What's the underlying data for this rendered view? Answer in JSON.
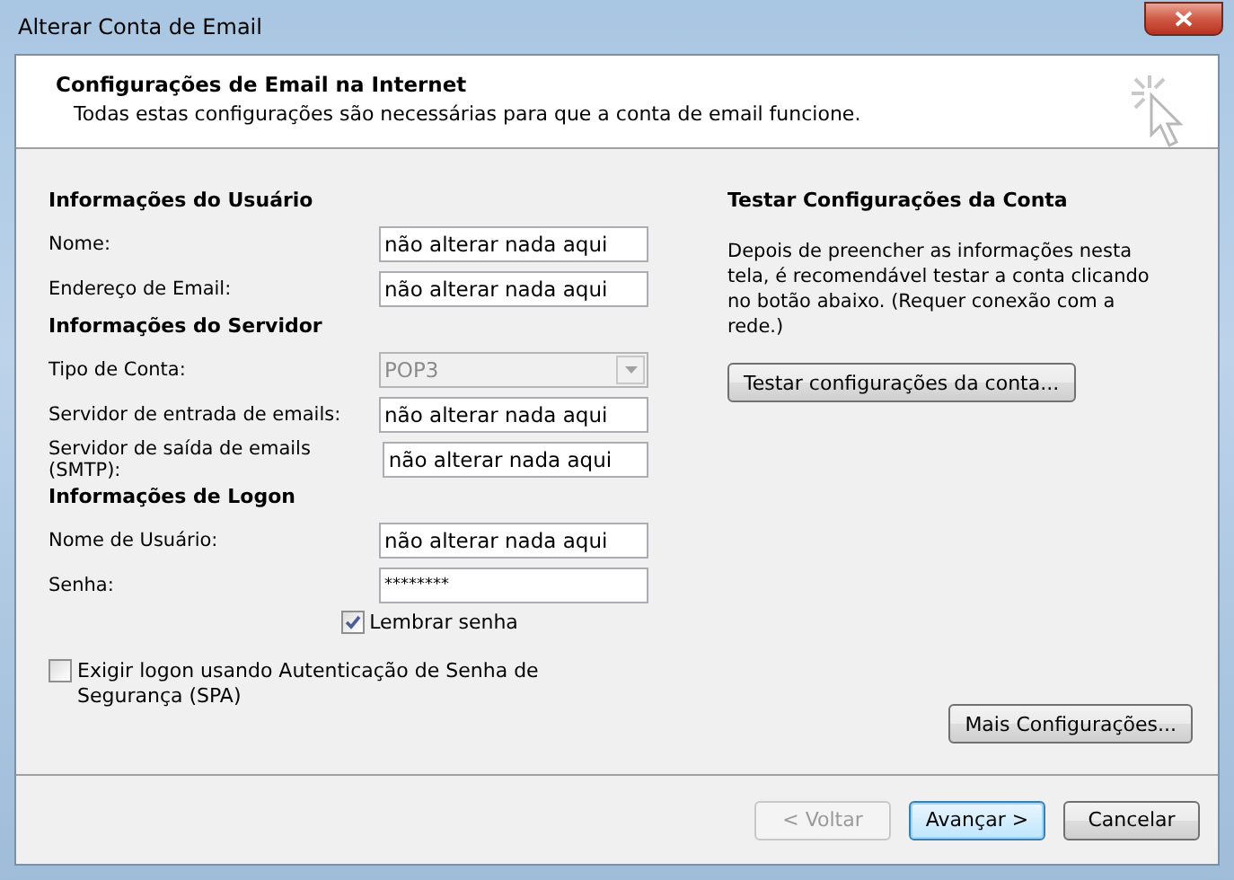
{
  "window": {
    "title": "Alterar Conta de Email"
  },
  "header": {
    "title": "Configurações de Email na Internet",
    "subtitle": "Todas estas configurações são necessárias para que a conta de email funcione."
  },
  "sections": [
    {
      "heading": "Informações do Usuário",
      "fields": [
        {
          "kind": "text",
          "label": "Nome:",
          "value": "não alterar nada aqui"
        },
        {
          "kind": "text",
          "label": "Endereço de Email:",
          "value": "não alterar nada aqui"
        }
      ]
    },
    {
      "heading": "Informações do Servidor",
      "fields": [
        {
          "kind": "select",
          "label": "Tipo de Conta:",
          "value": "POP3",
          "disabled": true
        },
        {
          "kind": "text",
          "label": "Servidor de entrada de emails:",
          "value": "não alterar nada aqui"
        },
        {
          "kind": "text",
          "label": "Servidor de saída de emails (SMTP):",
          "value": "não alterar nada aqui"
        }
      ]
    },
    {
      "heading": "Informações de Logon",
      "fields": [
        {
          "kind": "text",
          "label": "Nome de Usuário:",
          "value": "não alterar nada aqui"
        },
        {
          "kind": "password",
          "label": "Senha:",
          "value": "********"
        }
      ]
    }
  ],
  "remember_password": {
    "label": "Lembrar senha",
    "checked": true
  },
  "spa": {
    "label": "Exigir logon usando Autenticação de Senha de Segurança (SPA)",
    "checked": false
  },
  "test": {
    "heading": "Testar Configurações da Conta",
    "description": "Depois de preencher as informações nesta tela, é recomendável testar a conta clicando no botão abaixo. (Requer conexão com a rede.)",
    "button": "Testar configurações da conta..."
  },
  "more_button": "Mais Configurações...",
  "footer_buttons": [
    {
      "label": "< Voltar",
      "disabled": true,
      "default": false
    },
    {
      "label": "Avançar >",
      "disabled": false,
      "default": true
    },
    {
      "label": "Cancelar",
      "disabled": false,
      "default": false
    }
  ]
}
